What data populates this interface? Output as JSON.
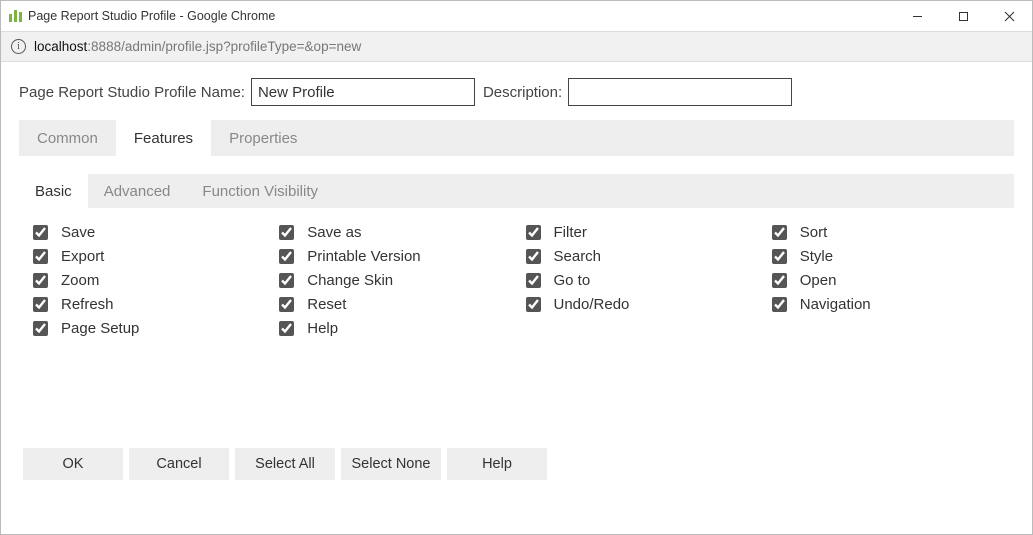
{
  "window": {
    "title": "Page Report Studio Profile - Google Chrome"
  },
  "addressbar": {
    "host": "localhost",
    "path": ":8888/admin/profile.jsp?profileType=&op=new"
  },
  "form": {
    "name_label": "Page Report Studio Profile Name:",
    "name_value": "New Profile",
    "description_label": "Description:",
    "description_value": ""
  },
  "tabs": {
    "items": [
      "Common",
      "Features",
      "Properties"
    ],
    "active": "Features"
  },
  "subtabs": {
    "items": [
      "Basic",
      "Advanced",
      "Function Visibility"
    ],
    "active": "Basic"
  },
  "features": {
    "columns": [
      [
        {
          "label": "Save",
          "checked": true
        },
        {
          "label": "Export",
          "checked": true
        },
        {
          "label": "Zoom",
          "checked": true
        },
        {
          "label": "Refresh",
          "checked": true
        },
        {
          "label": "Page Setup",
          "checked": true
        }
      ],
      [
        {
          "label": "Save as",
          "checked": true
        },
        {
          "label": "Printable Version",
          "checked": true
        },
        {
          "label": "Change Skin",
          "checked": true
        },
        {
          "label": "Reset",
          "checked": true
        },
        {
          "label": "Help",
          "checked": true
        }
      ],
      [
        {
          "label": "Filter",
          "checked": true
        },
        {
          "label": "Search",
          "checked": true
        },
        {
          "label": "Go to",
          "checked": true
        },
        {
          "label": "Undo/Redo",
          "checked": true
        }
      ],
      [
        {
          "label": "Sort",
          "checked": true
        },
        {
          "label": "Style",
          "checked": true
        },
        {
          "label": "Open",
          "checked": true
        },
        {
          "label": "Navigation",
          "checked": true
        }
      ]
    ]
  },
  "buttons": {
    "ok": "OK",
    "cancel": "Cancel",
    "select_all": "Select All",
    "select_none": "Select None",
    "help": "Help"
  }
}
